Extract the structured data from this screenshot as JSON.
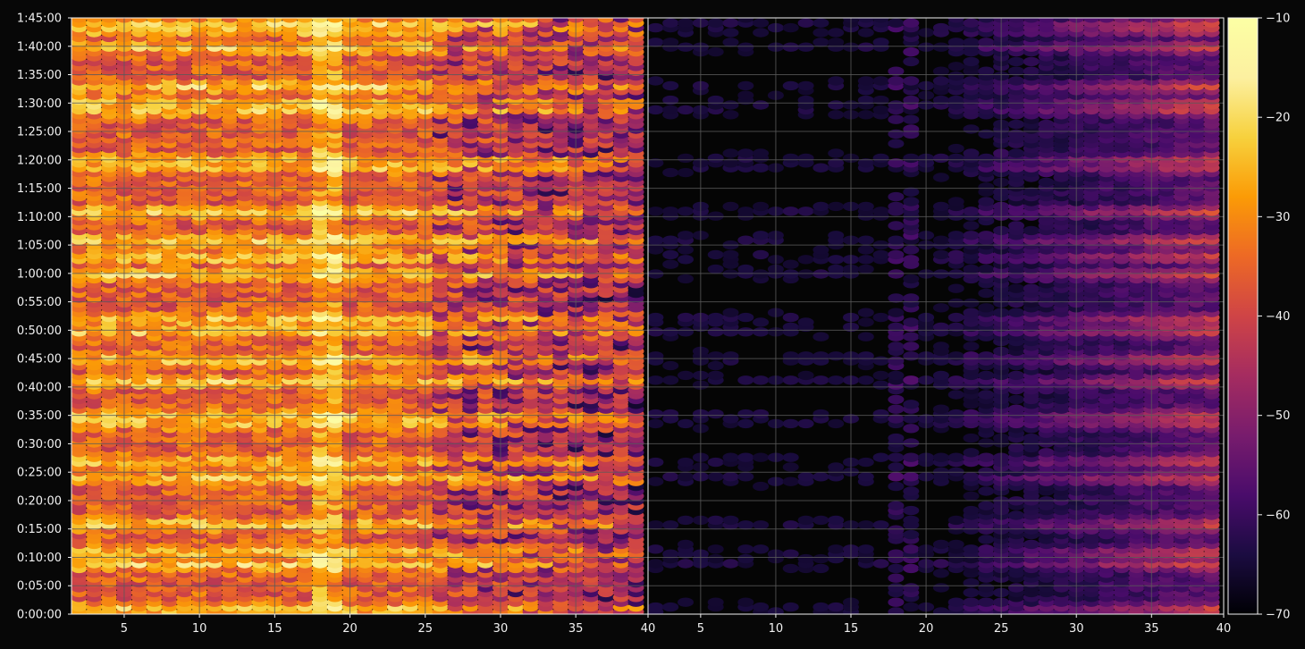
{
  "chart_data": {
    "type": "heatmap",
    "title": "",
    "xlabel": "",
    "ylabel": "",
    "grid": true,
    "panels": [
      {
        "xlim": [
          1.5,
          39.8
        ],
        "x_ticks": [
          5,
          10,
          15,
          20,
          25,
          30,
          35
        ],
        "description_intensity": "high",
        "x_ticks_labels": [
          "5",
          "10",
          "15",
          "20",
          "25",
          "30",
          "35"
        ]
      },
      {
        "xlim": [
          1.5,
          39.8
        ],
        "x_ticks": [
          5,
          10,
          15,
          20,
          25,
          30,
          35
        ],
        "x_ticks_labels": [
          "40",
          "5",
          "10",
          "15",
          "20",
          "25",
          "30",
          "35",
          "40"
        ]
      }
    ],
    "y_ticks": [
      "0:00:00",
      "0:05:00",
      "0:10:00",
      "0:15:00",
      "0:20:00",
      "0:25:00",
      "0:30:00",
      "0:35:00",
      "0:40:00",
      "0:45:00",
      "0:50:00",
      "0:55:00",
      "1:00:00",
      "1:05:00",
      "1:10:00",
      "1:15:00",
      "1:20:00",
      "1:25:00",
      "1:30:00",
      "1:35:00",
      "1:40:00",
      "1:45:00"
    ],
    "ylim_minutes": [
      0,
      105
    ],
    "colorbar": {
      "colormap": "inferno",
      "range": [
        -70,
        -10
      ],
      "ticks": [
        "−70",
        "−60",
        "−50",
        "−40",
        "−30",
        "−20",
        "−10"
      ]
    },
    "hot_rows_minutes": [
      1,
      9,
      11,
      16,
      24,
      27,
      34,
      35,
      41,
      45,
      50,
      52,
      60,
      63,
      66,
      71,
      79,
      80,
      89,
      90,
      93,
      100,
      103,
      104
    ],
    "hot_column_x": 18.5,
    "colors": {
      "background": "#070707",
      "grid": "#5a5a5a",
      "axes": "#f2f2f2"
    }
  }
}
